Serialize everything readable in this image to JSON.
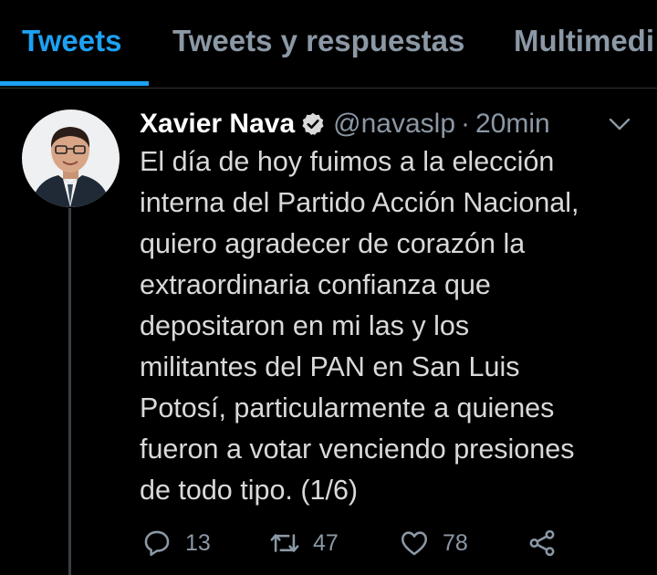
{
  "tabs": [
    {
      "label": "Tweets",
      "active": true
    },
    {
      "label": "Tweets y respuestas",
      "active": false
    },
    {
      "label": "Multimedi",
      "active": false
    }
  ],
  "tweet": {
    "author_name": "Xavier Nava",
    "handle": "@navaslp",
    "separator": "·",
    "time": "20min",
    "verified_icon": "verified-badge-icon",
    "text_lines": [
      "El día de hoy fuimos a la elección",
      "interna del Partido Acción Nacional,",
      "quiero agradecer de corazón la",
      "extraordinaria confianza que",
      "depositaron en mi las y los",
      "militantes del PAN en San Luis",
      "Potosí, particularmente a quienes",
      "fueron a votar venciendo presiones",
      "de todo tipo. (1/6)"
    ],
    "actions": {
      "reply_count": "13",
      "retweet_count": "47",
      "like_count": "78"
    }
  },
  "colors": {
    "background": "#000000",
    "accent": "#1da1f2",
    "muted": "#8b98a5",
    "text": "#d9d9d9"
  }
}
